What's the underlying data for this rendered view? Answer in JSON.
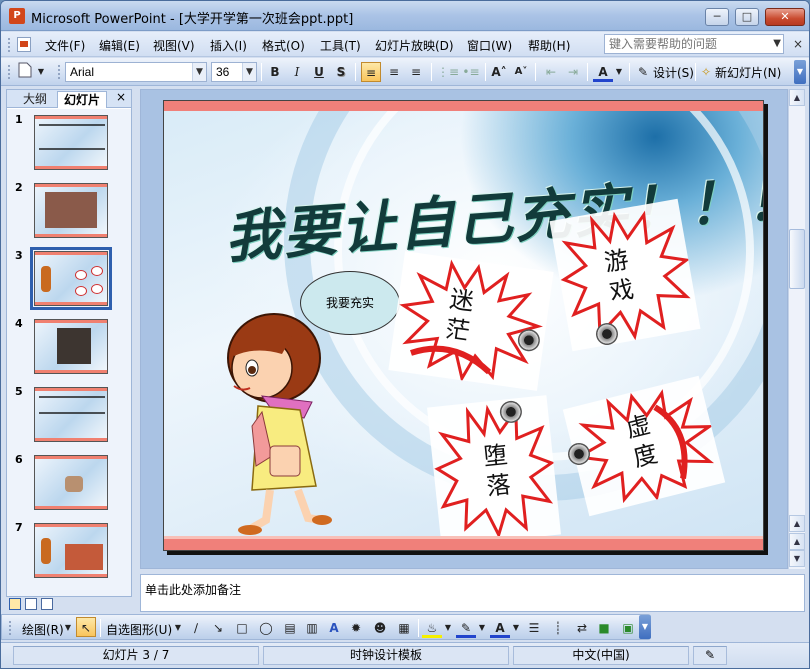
{
  "window": {
    "title": "Microsoft PowerPoint - [大学开学第一次班会ppt.ppt]",
    "app_icon": "powerpoint-icon"
  },
  "menu": {
    "items": [
      "文件(F)",
      "编辑(E)",
      "视图(V)",
      "插入(I)",
      "格式(O)",
      "工具(T)",
      "幻灯片放映(D)",
      "窗口(W)",
      "帮助(H)"
    ],
    "help_placeholder": "键入需要帮助的问题"
  },
  "format_toolbar": {
    "font_name": "Arial",
    "font_size": "36",
    "bold": "B",
    "italic": "I",
    "underline": "U",
    "shadow": "S",
    "design_label": "设计(S)",
    "new_slide_label": "新幻灯片(N)"
  },
  "left_pane": {
    "tab_outline": "大纲",
    "tab_slides": "幻灯片",
    "close": "×",
    "thumbnails": [
      "1",
      "2",
      "3",
      "4",
      "5",
      "6",
      "7"
    ],
    "selected": "3"
  },
  "slide": {
    "title": "我要让自己充实！！！",
    "bubble": "我要充实",
    "bursts": {
      "b1": "迷茫",
      "b2": "游戏",
      "b3": "堕落",
      "b4": "虚度"
    },
    "colors": {
      "accent_bar": "#f0807a",
      "burst_red": "#e02020",
      "title_dark": "#123b3b"
    }
  },
  "notes": {
    "placeholder": "单击此处添加备注"
  },
  "draw_toolbar": {
    "draw_label": "绘图(R)",
    "autoshapes_label": "自选图形(U)"
  },
  "status": {
    "slide_info": "幻灯片 3 / 7",
    "template": "时钟设计模板",
    "language": "中文(中国)"
  }
}
